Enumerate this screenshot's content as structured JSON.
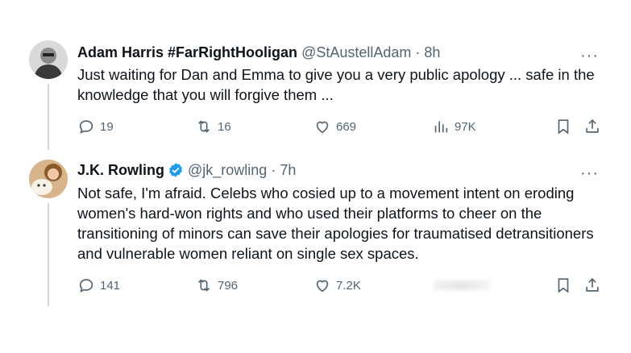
{
  "tweet1": {
    "display_name": "Adam Harris #FarRightHooligan",
    "handle": "@StAustellAdam",
    "separator": "·",
    "time": "8h",
    "more": "···",
    "text": "Just waiting for Dan and Emma to give you a very public apology ... safe in the knowledge that you will forgive them ...",
    "replies": "19",
    "retweets": "16",
    "likes": "669",
    "views": "97K"
  },
  "tweet2": {
    "display_name": "J.K. Rowling",
    "handle": "@jk_rowling",
    "separator": "·",
    "time": "7h",
    "more": "···",
    "text": "Not safe, I'm afraid. Celebs who cosied up to a movement intent on eroding women's hard-won rights and who used their platforms to cheer on the transitioning of minors can save their apologies for traumatised detransitioners and vulnerable women reliant on single sex spaces.",
    "replies": "141",
    "retweets": "796",
    "likes": "7.2K"
  },
  "colors": {
    "text": "#0f1419",
    "secondary": "#536471",
    "verified": "#1d9bf0",
    "thread_line": "#cfd9de"
  },
  "icons": [
    "reply-icon",
    "retweet-icon",
    "like-icon",
    "views-icon",
    "bookmark-icon",
    "share-icon",
    "verified-badge-icon",
    "more-icon"
  ]
}
